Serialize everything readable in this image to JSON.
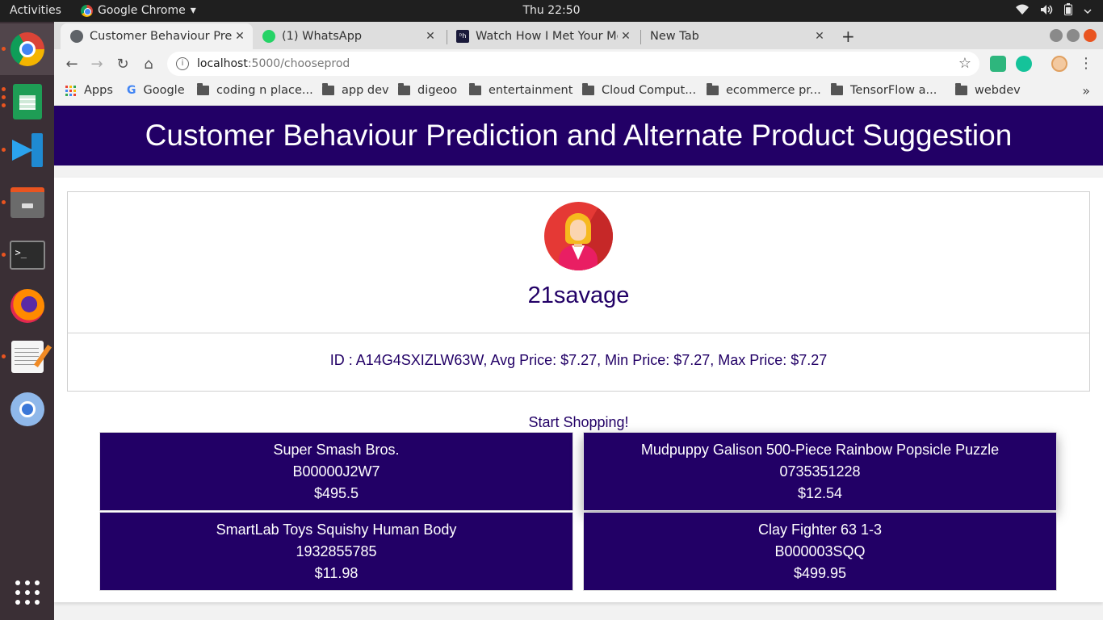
{
  "system_bar": {
    "activities": "Activities",
    "app_name": "Google Chrome",
    "app_menu_arrow": "▾",
    "clock": "Thu 22:50",
    "tray_icons": [
      "wifi-icon",
      "volume-icon",
      "battery-icon",
      "power-menu-icon"
    ]
  },
  "dock": {
    "apps": [
      "Google Chrome",
      "LibreOffice Calc",
      "Visual Studio Code",
      "Files",
      "Terminal",
      "Firefox",
      "Text Editor",
      "Chromium",
      "Show Applications"
    ],
    "terminal_prompt": ">_"
  },
  "browser": {
    "tabs": [
      {
        "title": "Customer Behaviour Prediction and Alternate Product Suggestion",
        "favicon": "globe-icon",
        "close": "✕",
        "active": true
      },
      {
        "title": "(1) WhatsApp",
        "favicon": "whatsapp-icon",
        "close": "✕",
        "active": false
      },
      {
        "title": "Watch How I Met Your Mother",
        "favicon": "dh-icon",
        "favicon_text": "ᴰh",
        "close": "✕",
        "active": false
      },
      {
        "title": "New Tab",
        "favicon": "",
        "close": "✕",
        "active": false
      }
    ],
    "new_tab": "+",
    "url_host": "localhost",
    "url_path": ":5000/chooseprod",
    "nav": {
      "back": "←",
      "forward": "→",
      "reload": "↻",
      "home": "⌂",
      "star": "☆",
      "menu": "⋮"
    },
    "bookmarks": [
      {
        "label": "Apps",
        "type": "apps"
      },
      {
        "label": "Google",
        "type": "google"
      },
      {
        "label": "coding n place...",
        "type": "folder"
      },
      {
        "label": "app dev",
        "type": "folder"
      },
      {
        "label": "digeoo",
        "type": "folder"
      },
      {
        "label": "entertainment",
        "type": "folder"
      },
      {
        "label": "Cloud Comput...",
        "type": "folder"
      },
      {
        "label": "ecommerce pr...",
        "type": "folder"
      },
      {
        "label": "TensorFlow a...",
        "type": "folder"
      },
      {
        "label": "webdev",
        "type": "folder"
      }
    ],
    "bookmarks_more": "»"
  },
  "page": {
    "header_title": "Customer Behaviour Prediction and Alternate Product Suggestion",
    "username": "21savage",
    "stats": "ID : A14G4SXIZLW63W, Avg Price: $7.27, Min Price: $7.27, Max Price: $7.27",
    "start_shopping": "Start Shopping!",
    "products": [
      {
        "name": "Super Smash Bros.",
        "id": "B00000J2W7",
        "price": "$495.5"
      },
      {
        "name": "Mudpuppy Galison 500-Piece Rainbow Popsicle Puzzle",
        "id": "0735351228",
        "price": "$12.54"
      },
      {
        "name": "SmartLab Toys Squishy Human Body",
        "id": "1932855785",
        "price": "$11.98"
      },
      {
        "name": "Clay Fighter 63 1-3",
        "id": "B000003SQQ",
        "price": "$499.95"
      }
    ]
  },
  "colors": {
    "brand": "#220066",
    "ubuntu_orange": "#e95420"
  }
}
